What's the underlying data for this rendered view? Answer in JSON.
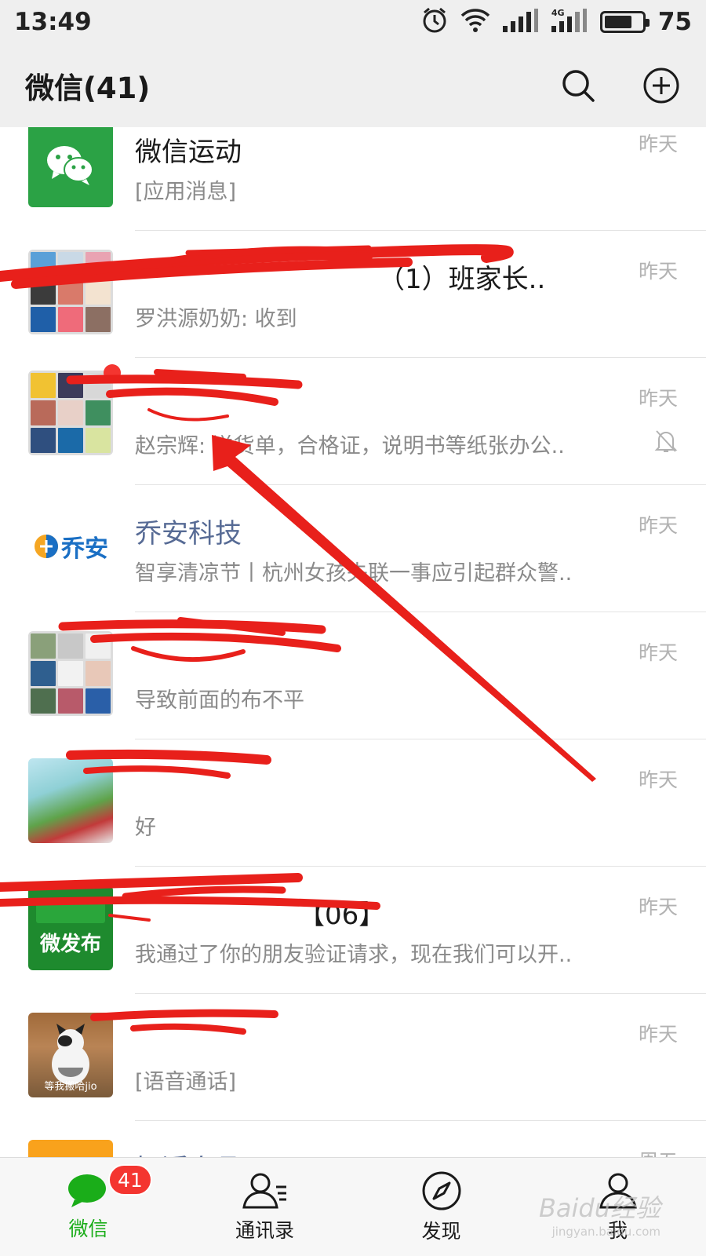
{
  "status_bar": {
    "time": "13:49",
    "network_label": "4G",
    "battery": "75",
    "battery_level": 0.75
  },
  "header": {
    "title": "微信(41)",
    "search_icon": "search-icon",
    "add_icon": "plus-circle-icon"
  },
  "chats": [
    {
      "name": "微信运动",
      "preview": "[应用消息]",
      "time": "昨天"
    },
    {
      "name": "（1）班家长..",
      "preview": "罗洪源奶奶: 收到",
      "time": "昨天"
    },
    {
      "name": "",
      "preview": "赵宗辉: 送货单，合格证，说明书等纸张办公..",
      "time": "昨天",
      "muted": true,
      "unread_dot": true
    },
    {
      "name": "乔安科技",
      "preview": "智享清凉节丨杭州女孩失联一事应引起群众警..",
      "time": "昨天",
      "logo_text": "乔安"
    },
    {
      "name": "",
      "preview": "导致前面的布不平",
      "time": "昨天"
    },
    {
      "name": "",
      "preview": "好",
      "time": "昨天"
    },
    {
      "name": "【06】",
      "preview": "我通过了你的朋友验证请求，现在我们可以开..",
      "time": "昨天",
      "avatar_text": "微发布"
    },
    {
      "name": "",
      "preview": "[语音通话]",
      "time": "昨天",
      "avatar_caption": "等我搬哈jio"
    },
    {
      "name": "好近自品",
      "preview": "",
      "time": "周五"
    }
  ],
  "tabs": [
    {
      "label": "微信",
      "badge": "41",
      "icon": "chat-bubble-icon"
    },
    {
      "label": "通讯录",
      "icon": "contacts-icon"
    },
    {
      "label": "发现",
      "icon": "compass-icon"
    },
    {
      "label": "我",
      "icon": "person-icon"
    }
  ],
  "watermark": {
    "main": "Baidu经验",
    "sub": "jingyan.baidu.com"
  },
  "colors": {
    "accent_green": "#1aad19",
    "badge_red": "#f43530",
    "header_bg": "#efefef",
    "official_name": "#576b95",
    "annotation_red": "#e8201b"
  }
}
